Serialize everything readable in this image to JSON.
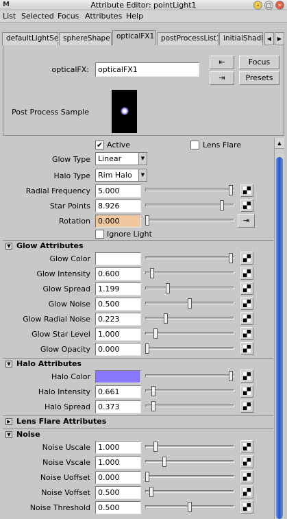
{
  "window": {
    "title": "Attribute Editor: pointLight1",
    "app_icon": "M"
  },
  "menu": [
    "List",
    "Selected",
    "Focus",
    "Attributes",
    "Help"
  ],
  "tabs": [
    "defaultLightSet",
    "sphereShape1",
    "opticalFX1",
    "postProcessList1",
    "initialShadin"
  ],
  "header": {
    "node_label": "opticalFX:",
    "node_value": "opticalFX1",
    "focus_label": "Focus",
    "presets_label": "Presets",
    "sample_label": "Post Process Sample"
  },
  "main": {
    "active_label": "Active",
    "active_checked": "✔",
    "lens_flare_label": "Lens Flare",
    "lens_flare_checked": "",
    "glow_type_label": "Glow Type",
    "glow_type_value": "Linear",
    "halo_type_label": "Halo Type",
    "halo_type_value": "Rim Halo",
    "radial_frequency_label": "Radial Frequency",
    "radial_frequency_value": "5.000",
    "radial_frequency_level": 0.98,
    "star_points_label": "Star Points",
    "star_points_value": "8.926",
    "star_points_level": 0.88,
    "rotation_label": "Rotation",
    "rotation_value": "0.000",
    "rotation_level": 0.0,
    "ignore_light_label": "Ignore Light",
    "ignore_light_checked": ""
  },
  "glow": {
    "title": "Glow Attributes",
    "rows": [
      {
        "label": "Glow Color",
        "value": "",
        "level": 0.98
      },
      {
        "label": "Glow Intensity",
        "value": "0.600",
        "level": 0.06
      },
      {
        "label": "Glow Spread",
        "value": "1.199",
        "level": 0.24
      },
      {
        "label": "Glow Noise",
        "value": "0.500",
        "level": 0.5
      },
      {
        "label": "Glow Radial Noise",
        "value": "0.223",
        "level": 0.22
      },
      {
        "label": "Glow Star Level",
        "value": "1.000",
        "level": 0.1
      },
      {
        "label": "Glow Opacity",
        "value": "0.000",
        "level": 0.0
      }
    ],
    "color": "#ffffff"
  },
  "halo": {
    "title": "Halo Attributes",
    "rows": [
      {
        "label": "Halo Color",
        "value": "",
        "level": 0.98
      },
      {
        "label": "Halo Intensity",
        "value": "0.661",
        "level": 0.07
      },
      {
        "label": "Halo Spread",
        "value": "0.373",
        "level": 0.07
      }
    ],
    "color": "#8a78ff"
  },
  "lens_flare": {
    "title": "Lens Flare Attributes"
  },
  "noise": {
    "title": "Noise",
    "rows": [
      {
        "label": "Noise Uscale",
        "value": "1.000",
        "level": 0.1
      },
      {
        "label": "Noise Vscale",
        "value": "1.000",
        "level": 0.2
      },
      {
        "label": "Noise Uoffset",
        "value": "0.000",
        "level": 0.0
      },
      {
        "label": "Noise Voffset",
        "value": "0.500",
        "level": 0.05
      },
      {
        "label": "Noise Threshold",
        "value": "0.500",
        "level": 0.5
      }
    ]
  },
  "colors": {
    "rotation_field": "#f0c8a0",
    "scroll_thumb": "#2456c8",
    "sample_glow": "#c8b8ff"
  }
}
